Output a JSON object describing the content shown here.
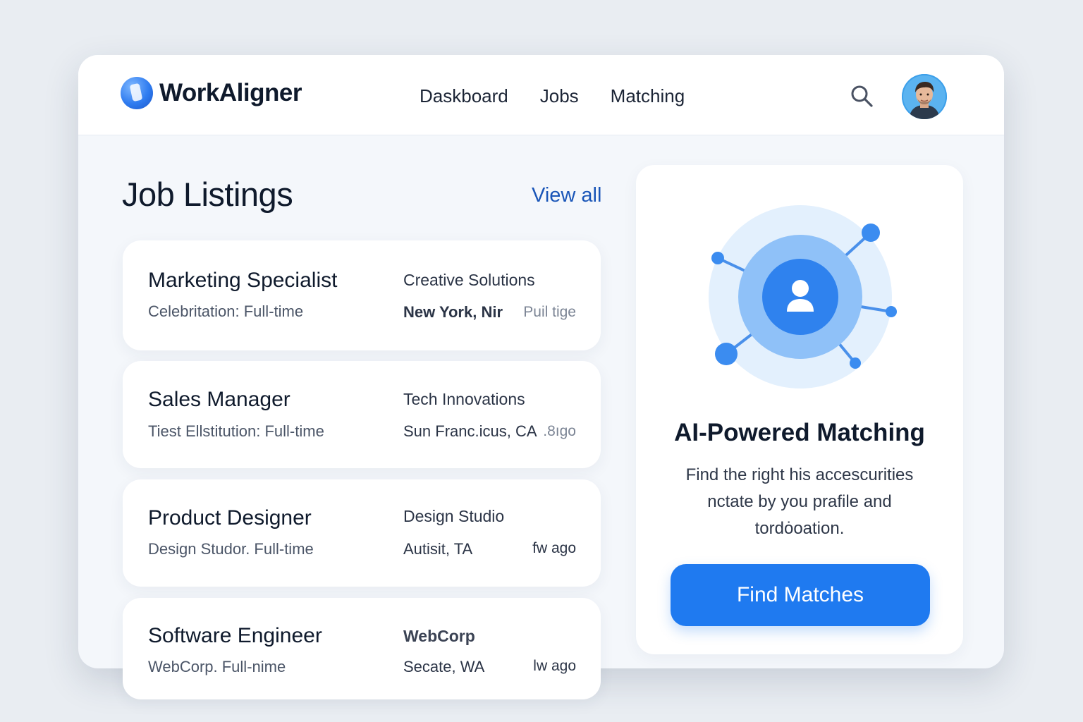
{
  "app": {
    "name": "WorkAligner"
  },
  "nav": {
    "items": [
      {
        "label": "Daskboard"
      },
      {
        "label": "Jobs"
      },
      {
        "label": "Matching"
      }
    ]
  },
  "icons": {
    "search": "search-icon",
    "avatar": "user-avatar",
    "logo": "logo-icon",
    "match": "user-network-icon"
  },
  "listings": {
    "title": "Job Listings",
    "view_all": "View all",
    "jobs": [
      {
        "title": "Marketing Specialist",
        "sub": "Celebritation: Full-time",
        "company": "Creative Solutions",
        "location": "New York, Nir",
        "time": "Puil tige"
      },
      {
        "title": "Sales Manager",
        "sub": "Tiest Ellstitution:  Full-time",
        "company": "Tech Innovations",
        "location": "Sun Franc.icus, CA",
        "time": ".8ıgo"
      },
      {
        "title": "Product Designer",
        "sub": "Design Studor. Full-time",
        "company": "Design Studio",
        "location": "Autisit, TA",
        "time": "fw ago"
      },
      {
        "title": "Software Engineer",
        "sub": "WebCorp.  Full-nime",
        "company": "WebCorp",
        "location": "Secate, WA",
        "time": "lw ago"
      }
    ]
  },
  "matching": {
    "title": "AI-Powered Matching",
    "description": "Find the right his accescurities nctate by you prafile and tordȯoation.",
    "button": "Find Matches"
  },
  "colors": {
    "accent": "#1f7af0",
    "link": "#1a56b8",
    "background": "#e9edf2"
  }
}
